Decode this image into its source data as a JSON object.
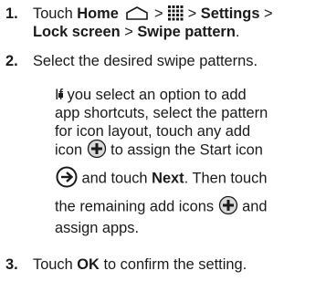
{
  "steps": [
    {
      "number": "1.",
      "parts": {
        "t1": "Touch ",
        "home": "Home",
        "gt1": " > ",
        "gt2": " > ",
        "settings": "Settings",
        "gt3": " >",
        "lock": "Lock screen",
        "gt4": " > ",
        "swipe": "Swipe pattern",
        "end": "."
      },
      "icons": [
        "home-icon",
        "apps-grid-icon"
      ]
    },
    {
      "number": "2.",
      "text": "Select the desired swipe patterns."
    },
    {
      "bullet": {
        "l1": "If you select an option to add",
        "l2": "app shortcuts, select the pattern",
        "l3a": "for icon layout, touch any add",
        "l4a": "icon ",
        "l4b": " to assign the Start icon",
        "l5a": " and touch ",
        "next": "Next",
        "l5b": ". Then touch",
        "l6a": "the remaining add icons ",
        "l6b": " and",
        "l7": "assign apps."
      },
      "icons": [
        "add-icon",
        "start-icon"
      ]
    },
    {
      "number": "3.",
      "parts": {
        "t1": "Touch ",
        "ok": "OK",
        "t2": " to confirm the setting."
      }
    }
  ],
  "colors": {
    "text": "#1a1a1a",
    "icon_fill": "#d9d9d9"
  }
}
